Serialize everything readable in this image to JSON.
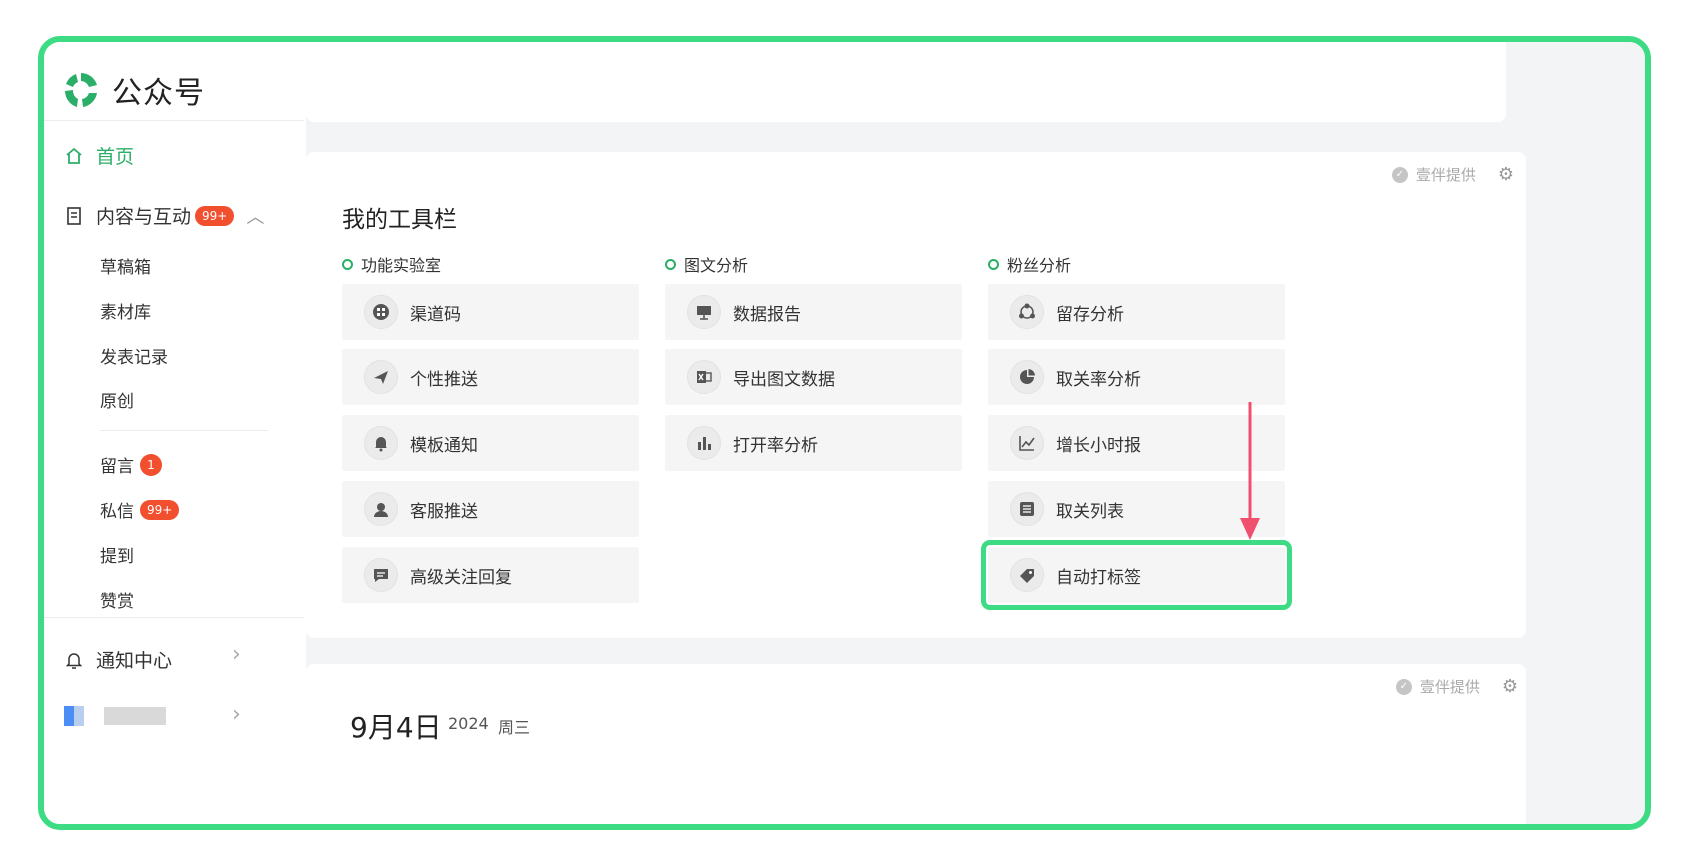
{
  "app": {
    "title": "公众号"
  },
  "sidebar": {
    "home": "首页",
    "content": {
      "label": "内容与互动",
      "badge": "99+"
    },
    "content_items": [
      "草稿箱",
      "素材库",
      "发表记录",
      "原创"
    ],
    "interaction_items": [
      {
        "label": "留言",
        "badge": "1"
      },
      {
        "label": "私信",
        "badge": "99+"
      },
      {
        "label": "提到",
        "badge": ""
      },
      {
        "label": "赞赏",
        "badge": ""
      }
    ],
    "notify": "通知中心"
  },
  "toolbar_card": {
    "title": "我的工具栏",
    "provider": "壹伴提供",
    "categories": [
      "功能实验室",
      "图文分析",
      "粉丝分析"
    ],
    "col1": [
      "渠道码",
      "个性推送",
      "模板通知",
      "客服推送",
      "高级关注回复"
    ],
    "col2": [
      "数据报告",
      "导出图文数据",
      "打开率分析"
    ],
    "col3": [
      "留存分析",
      "取关率分析",
      "增长小时报",
      "取关列表",
      "自动打标签"
    ]
  },
  "date_card": {
    "provider": "壹伴提供",
    "date": "9月4日",
    "year": "2024",
    "weekday": "周三"
  },
  "colors": {
    "accent": "#2bae67",
    "highlight": "#3ddc84",
    "badge": "#f24f2f",
    "arrow": "#f0506e"
  },
  "icons": {
    "col1": [
      "qrcode-icon",
      "send-icon",
      "bell-icon",
      "service-icon",
      "reply-icon"
    ],
    "col2": [
      "presentation-icon",
      "excel-icon",
      "bar-chart-icon"
    ],
    "col3": [
      "retention-icon",
      "pie-chart-icon",
      "line-chart-icon",
      "list-icon",
      "tag-icon"
    ]
  }
}
